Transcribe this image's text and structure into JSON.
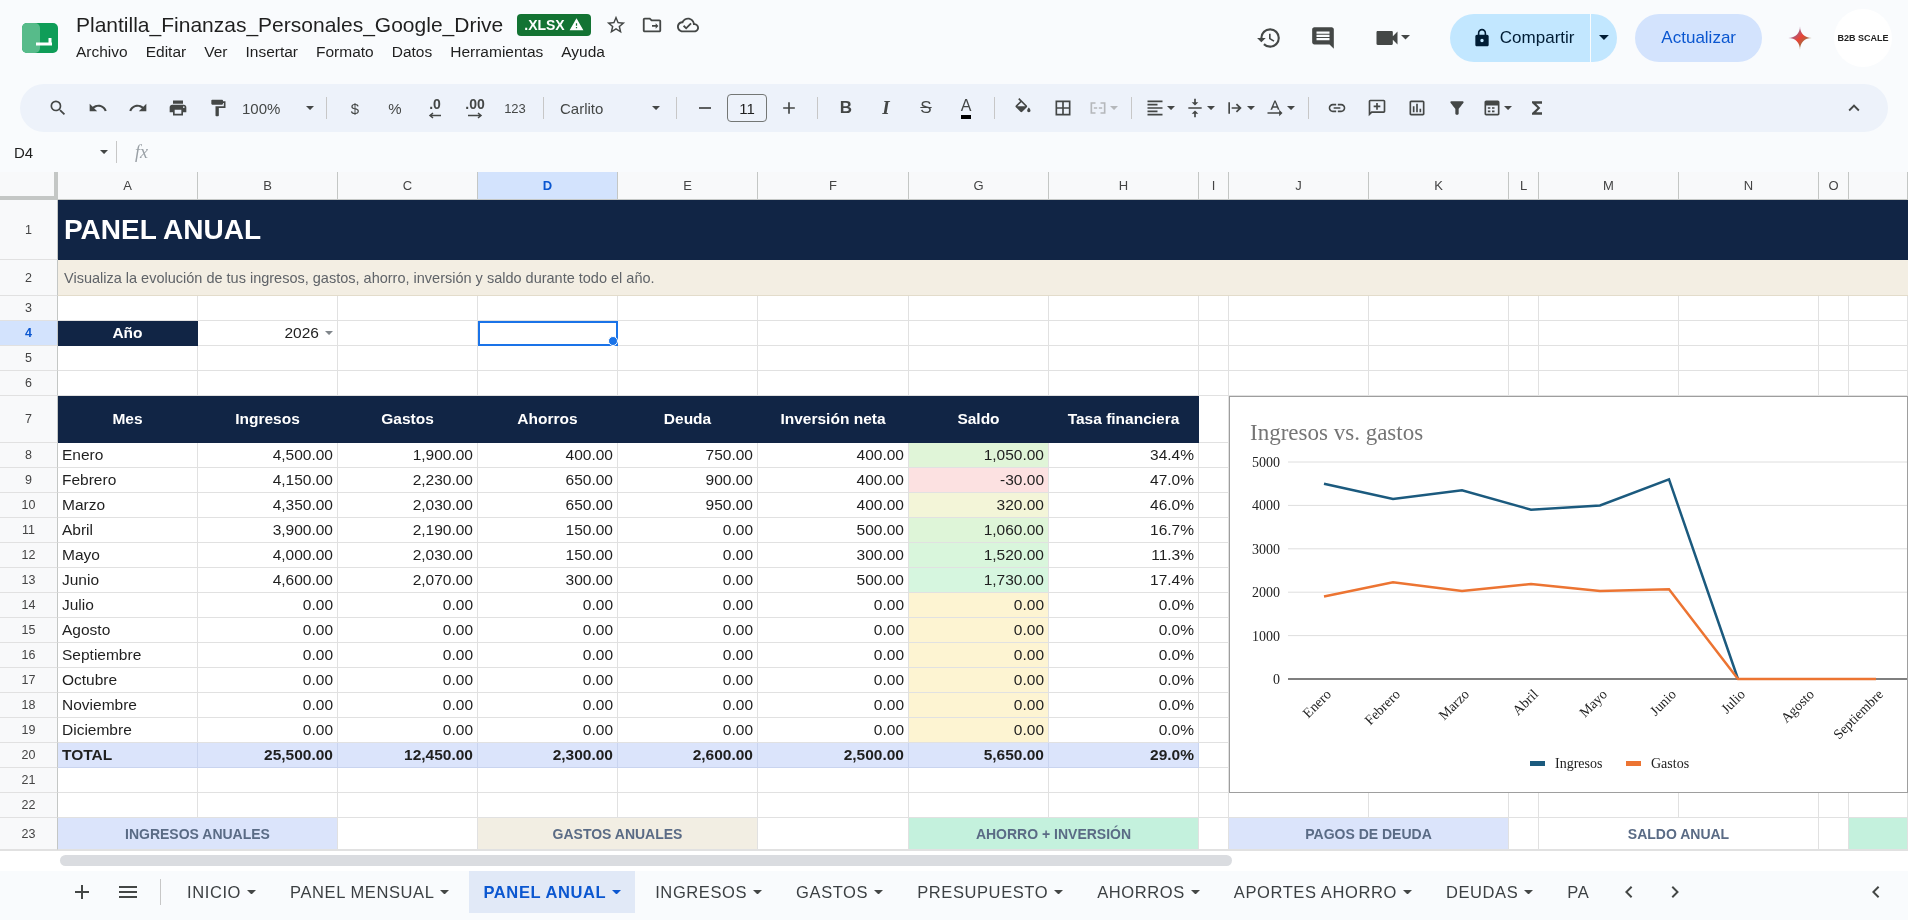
{
  "title_bar": {
    "file_name": "Plantilla_Finanzas_Personales_Google_Drive",
    "badge": ".XLSX",
    "menu": [
      "Archivo",
      "Editar",
      "Ver",
      "Insertar",
      "Formato",
      "Datos",
      "Herramientas",
      "Ayuda"
    ],
    "share_button": "Compartir",
    "update_button": "Actualizar",
    "avatar": "B2B SCALE"
  },
  "toolbar": {
    "zoom": "100%",
    "currency": "$",
    "percent": "%",
    "decrease_decimals": ".0",
    "increase_decimals": ".00",
    "number_format": "123",
    "font": "Carlito",
    "font_size": "11",
    "text_styles": [
      {
        "label": "B",
        "kind": "bold"
      },
      {
        "label": "I",
        "kind": "italic"
      },
      {
        "label": "S",
        "kind": "strike"
      },
      {
        "label": "A",
        "kind": "color"
      }
    ]
  },
  "formula_bar": {
    "name_box": "D4",
    "fx": "fx"
  },
  "columns": [
    {
      "label": "A",
      "selected": false
    },
    {
      "label": "B",
      "selected": false
    },
    {
      "label": "C",
      "selected": false
    },
    {
      "label": "D",
      "selected": true
    },
    {
      "label": "E",
      "selected": false
    },
    {
      "label": "F",
      "selected": false
    },
    {
      "label": "G",
      "selected": false
    },
    {
      "label": "H",
      "selected": false
    },
    {
      "label": "I",
      "selected": false
    },
    {
      "label": "J",
      "selected": false
    },
    {
      "label": "K",
      "selected": false
    },
    {
      "label": "L",
      "selected": false
    },
    {
      "label": "M",
      "selected": false
    },
    {
      "label": "N",
      "selected": false
    },
    {
      "label": "O",
      "selected": false
    }
  ],
  "row_numbers": [
    {
      "label": "1",
      "selected": false
    },
    {
      "label": "2",
      "selected": false
    },
    {
      "label": "3",
      "selected": false
    },
    {
      "label": "4",
      "selected": true
    },
    {
      "label": "5",
      "selected": false
    },
    {
      "label": "6",
      "selected": false
    },
    {
      "label": "7",
      "selected": false
    },
    {
      "label": "8",
      "selected": false
    },
    {
      "label": "9",
      "selected": false
    },
    {
      "label": "10",
      "selected": false
    },
    {
      "label": "11",
      "selected": false
    },
    {
      "label": "12",
      "selected": false
    },
    {
      "label": "13",
      "selected": false
    },
    {
      "label": "14",
      "selected": false
    },
    {
      "label": "15",
      "selected": false
    },
    {
      "label": "16",
      "selected": false
    },
    {
      "label": "17",
      "selected": false
    },
    {
      "label": "18",
      "selected": false
    },
    {
      "label": "19",
      "selected": false
    },
    {
      "label": "20",
      "selected": false
    },
    {
      "label": "21",
      "selected": false
    },
    {
      "label": "22",
      "selected": false
    },
    {
      "label": "23",
      "selected": false
    }
  ],
  "sheet": {
    "title": "PANEL ANUAL",
    "subtitle": "Visualiza la evolución de tus ingresos, gastos, ahorro, inversión y saldo durante todo el año.",
    "year_label": "Año",
    "year_value": "2026",
    "table": {
      "columns": [
        "Mes",
        "Ingresos",
        "Gastos",
        "Ahorros",
        "Deuda",
        "Inversión neta",
        "Saldo",
        "Tasa financiera"
      ],
      "rows": [
        {
          "cells": [
            "Enero",
            "4,500.00",
            "1,900.00",
            "400.00",
            "750.00",
            "400.00",
            "1,050.00",
            "34.4%"
          ],
          "color": "#e0f5d8"
        },
        {
          "cells": [
            "Febrero",
            "4,150.00",
            "2,230.00",
            "650.00",
            "900.00",
            "400.00",
            "-30.00",
            "47.0%"
          ],
          "color": "#fce1e1"
        },
        {
          "cells": [
            "Marzo",
            "4,350.00",
            "2,030.00",
            "650.00",
            "950.00",
            "400.00",
            "320.00",
            "46.0%"
          ],
          "color": "#f3f5d8"
        },
        {
          "cells": [
            "Abril",
            "3,900.00",
            "2,190.00",
            "150.00",
            "0.00",
            "500.00",
            "1,060.00",
            "16.7%"
          ],
          "color": "#def5d8"
        },
        {
          "cells": [
            "Mayo",
            "4,000.00",
            "2,030.00",
            "150.00",
            "0.00",
            "300.00",
            "1,520.00",
            "11.3%"
          ],
          "color": "#d9f6dc"
        },
        {
          "cells": [
            "Junio",
            "4,600.00",
            "2,070.00",
            "300.00",
            "0.00",
            "500.00",
            "1,730.00",
            "17.4%"
          ],
          "color": "#d6f6df"
        },
        {
          "cells": [
            "Julio",
            "0.00",
            "0.00",
            "0.00",
            "0.00",
            "0.00",
            "0.00",
            "0.0%"
          ],
          "color": "#fdf4d2"
        },
        {
          "cells": [
            "Agosto",
            "0.00",
            "0.00",
            "0.00",
            "0.00",
            "0.00",
            "0.00",
            "0.0%"
          ],
          "color": "#fdf4d2"
        },
        {
          "cells": [
            "Septiembre",
            "0.00",
            "0.00",
            "0.00",
            "0.00",
            "0.00",
            "0.00",
            "0.0%"
          ],
          "color": "#fdf4d2"
        },
        {
          "cells": [
            "Octubre",
            "0.00",
            "0.00",
            "0.00",
            "0.00",
            "0.00",
            "0.00",
            "0.0%"
          ],
          "color": "#fdf4d2"
        },
        {
          "cells": [
            "Noviembre",
            "0.00",
            "0.00",
            "0.00",
            "0.00",
            "0.00",
            "0.00",
            "0.0%"
          ],
          "color": "#fdf4d2"
        },
        {
          "cells": [
            "Diciembre",
            "0.00",
            "0.00",
            "0.00",
            "0.00",
            "0.00",
            "0.00",
            "0.0%"
          ],
          "color": "#fdf4d2"
        }
      ],
      "total": [
        "TOTAL",
        "25,500.00",
        "12,450.00",
        "2,300.00",
        "2,600.00",
        "2,500.00",
        "5,650.00",
        "29.0%"
      ]
    },
    "summary_cards": [
      {
        "label": "INGRESOS ANUALES",
        "color": "#dbe4fb"
      },
      {
        "label": "GASTOS ANUALES",
        "color": "#f2eee3"
      },
      {
        "label": "AHORRO + INVERSIÓN",
        "color": "#c4f1dd"
      },
      {
        "label": "PAGOS DE DEUDA",
        "color": "#dbe4fb"
      },
      {
        "label": "SALDO ANUAL",
        "color": "#ffffff"
      },
      {
        "color": "#c4f1dd"
      }
    ]
  },
  "chart": {
    "chart_data": {
      "type": "line",
      "title": "Ingresos vs. gastos",
      "categories": [
        "Enero",
        "Febrero",
        "Marzo",
        "Abril",
        "Mayo",
        "Junio",
        "Julio",
        "Agosto",
        "Septiembre"
      ],
      "series": [
        {
          "name": "Ingresos",
          "color": "#1b5a7e",
          "values": [
            4500,
            4150,
            4350,
            3900,
            4000,
            4600,
            0,
            null,
            null
          ]
        },
        {
          "name": "Gastos",
          "color": "#ec7432",
          "values": [
            1900,
            2230,
            2030,
            2190,
            2030,
            2070,
            0,
            0,
            0
          ]
        }
      ],
      "ylim": [
        0,
        5000
      ],
      "yticks": [
        0,
        1000,
        2000,
        3000,
        4000,
        5000
      ],
      "grid": true,
      "legend": true
    }
  },
  "sheet_tabs": [
    {
      "label": "INICIO",
      "selected": false
    },
    {
      "label": "PANEL MENSUAL",
      "selected": false
    },
    {
      "label": "PANEL ANUAL",
      "selected": true
    },
    {
      "label": "INGRESOS",
      "selected": false
    },
    {
      "label": "GASTOS",
      "selected": false
    },
    {
      "label": "PRESUPUESTO",
      "selected": false
    },
    {
      "label": "AHORROS",
      "selected": false
    },
    {
      "label": "APORTES AHORRO",
      "selected": false
    },
    {
      "label": "DEUDAS",
      "selected": false
    },
    {
      "label": "PA",
      "selected": false
    }
  ]
}
